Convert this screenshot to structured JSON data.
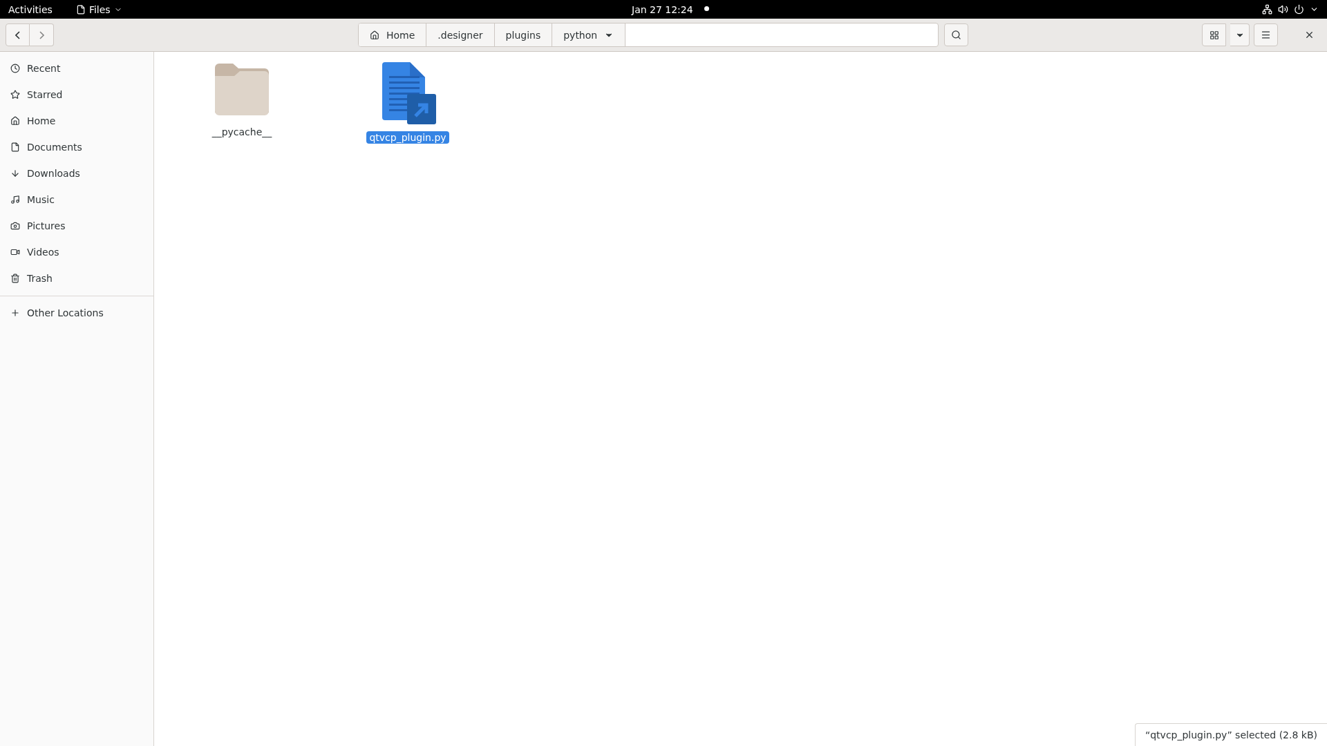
{
  "top_bar": {
    "activities": "Activities",
    "app_menu": "Files",
    "clock": "Jan 27  12:24"
  },
  "header": {
    "path": [
      {
        "label": "Home",
        "kind": "home"
      },
      {
        "label": ".designer",
        "kind": "folder"
      },
      {
        "label": "plugins",
        "kind": "folder"
      },
      {
        "label": "python",
        "kind": "current"
      }
    ]
  },
  "sidebar": {
    "items": [
      {
        "label": "Recent",
        "kind": "recent",
        "selected": false
      },
      {
        "label": "Starred",
        "kind": "starred",
        "selected": false
      },
      {
        "label": "Home",
        "kind": "home",
        "selected": false
      },
      {
        "label": "Documents",
        "kind": "documents",
        "selected": false
      },
      {
        "label": "Downloads",
        "kind": "downloads",
        "selected": false
      },
      {
        "label": "Music",
        "kind": "music",
        "selected": false
      },
      {
        "label": "Pictures",
        "kind": "pictures",
        "selected": false
      },
      {
        "label": "Videos",
        "kind": "videos",
        "selected": false
      },
      {
        "label": "Trash",
        "kind": "trash",
        "selected": false
      }
    ],
    "other": {
      "label": "Other Locations"
    }
  },
  "files": [
    {
      "name": "__pycache__",
      "kind": "folder",
      "selected": false
    },
    {
      "name": "qtvcp_plugin.py",
      "kind": "link",
      "selected": true
    }
  ],
  "status": "“qtvcp_plugin.py” selected  (2.8 kB)"
}
